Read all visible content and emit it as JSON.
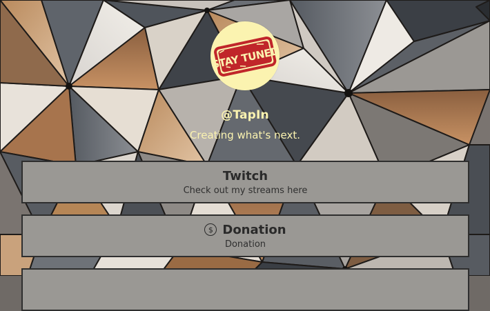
{
  "profile": {
    "handle": "@TapIn",
    "tagline": "Creating what's next.",
    "avatar_text": "STAY TUNED",
    "avatar_icon": "stay-tuned-stamp-logo"
  },
  "links": [
    {
      "title": "Twitch",
      "subtitle": "Check out my streams here",
      "icon": ""
    },
    {
      "title": "Donation",
      "subtitle": "Donation",
      "icon": "dollar-circle-icon"
    },
    {
      "title": "",
      "subtitle": "",
      "icon": ""
    }
  ],
  "colors": {
    "accent_text": "#fbf3b0",
    "card_bg": "#9a9894",
    "card_border": "#2e2e2e",
    "stamp_red": "#c0262a"
  }
}
